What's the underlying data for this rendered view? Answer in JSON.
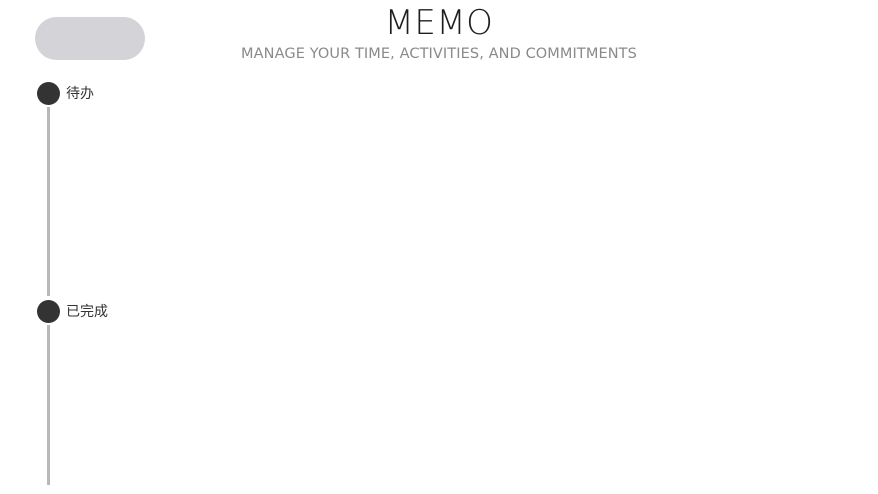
{
  "header": {
    "title": "MEMO",
    "subtitle": "MANAGE YOUR TIME, ACTIVITIES, AND COMMITMENTS"
  },
  "sections": [
    {
      "label": "待办",
      "items": []
    },
    {
      "label": "已完成",
      "items": []
    }
  ],
  "colors": {
    "button_bg": "#d3d3d8",
    "dot": "#333333",
    "timeline": "#b8b8b8",
    "subtitle": "#8a8a8a"
  }
}
